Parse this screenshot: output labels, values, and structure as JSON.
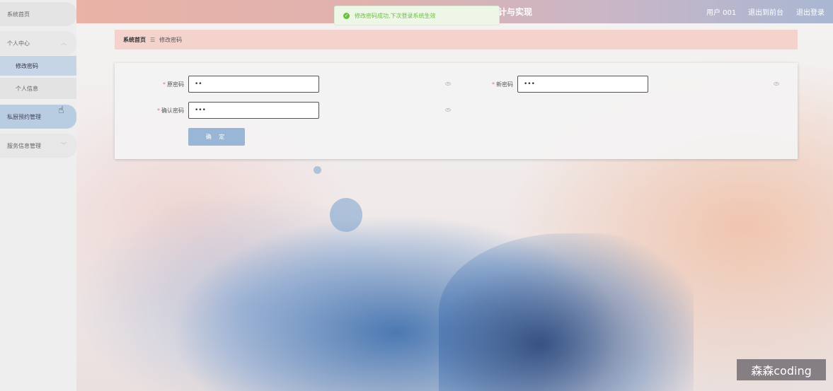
{
  "header": {
    "title_fragment": "计与实现",
    "user_label": "用户 001",
    "nav_front": "退出到前台",
    "nav_logout": "退出登录"
  },
  "toast": {
    "message": "修改密码成功,下次登录系统生效",
    "icon": "check-circle-icon",
    "color": "#67c23a"
  },
  "sidebar": {
    "items": [
      {
        "label": "系统首页"
      },
      {
        "label": "个人中心",
        "icon": "chevron-up-icon"
      },
      {
        "label": "修改密码",
        "active": true
      },
      {
        "label": "个人信息"
      },
      {
        "label": "私厨预约管理",
        "icon": "chevron-down-icon"
      },
      {
        "label": "服务信息管理",
        "icon": "chevron-down-icon"
      }
    ]
  },
  "breadcrumb": {
    "home": "系统首页",
    "separator": "☰",
    "current": "修改密码"
  },
  "form": {
    "old_password_label": "原密码",
    "old_password_value": "••",
    "new_password_label": "新密码",
    "new_password_value": "•••",
    "confirm_password_label": "确认密码",
    "confirm_password_value": "•••",
    "submit_label": "确 定",
    "required_mark": "*",
    "accent": "#9ab6d6"
  },
  "watermark": {
    "text": "森森coding"
  }
}
